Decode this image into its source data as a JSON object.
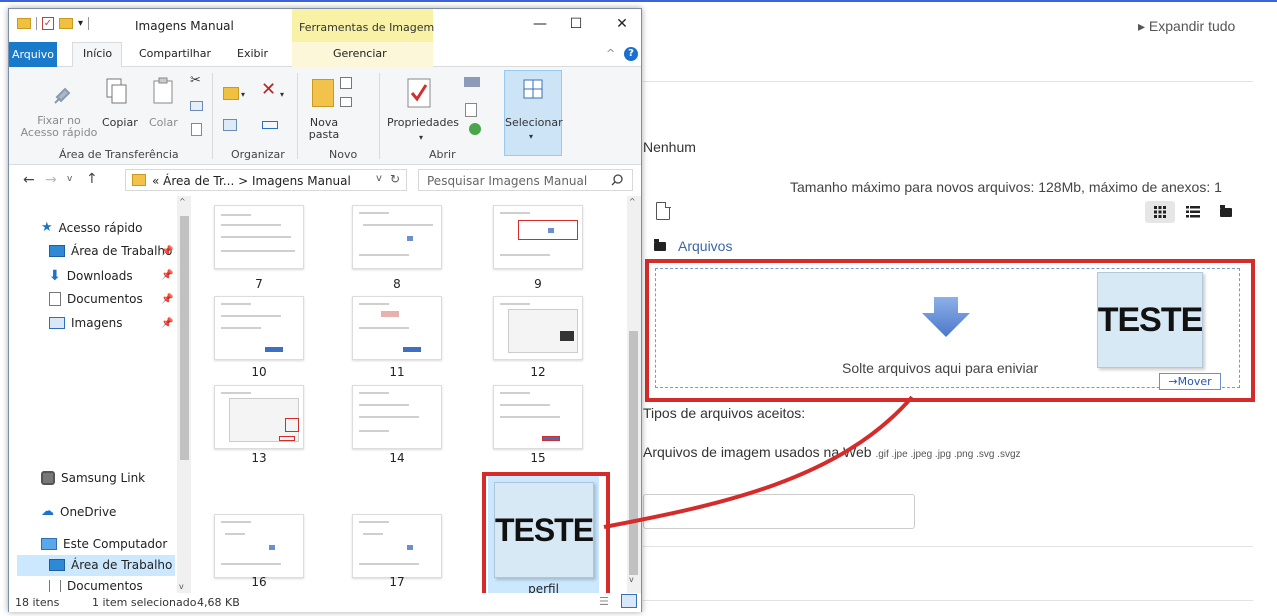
{
  "explorer": {
    "title": "Imagens Manual",
    "tools_tab": "Ferramentas de Imagem",
    "tabs": {
      "file": "Arquivo",
      "home": "Início",
      "share": "Compartilhar",
      "view": "Exibir",
      "manage": "Gerenciar"
    },
    "ribbon": {
      "pin_line1": "Fixar no",
      "pin_line2": "Acesso rápido",
      "copy": "Copiar",
      "paste": "Colar",
      "new_folder_1": "Nova",
      "new_folder_2": "pasta",
      "properties": "Propriedades",
      "select": "Selecionar",
      "groups": {
        "clipboard": "Área de Transferência",
        "organize": "Organizar",
        "new": "Novo",
        "open": "Abrir"
      }
    },
    "address": {
      "path_prefix": "«",
      "path_1": "Área de Tr...",
      "sep": ">",
      "path_2": "Imagens Manual",
      "search_placeholder": "Pesquisar Imagens Manual"
    },
    "nav": {
      "quick_access": "Acesso rápido",
      "desktop": "Área de Trabalho",
      "downloads": "Downloads",
      "documents": "Documentos",
      "images": "Imagens",
      "samsung": "Samsung Link",
      "onedrive": "OneDrive",
      "this_pc": "Este Computador",
      "desktop2": "Área de Trabalho",
      "documents2": "Documentos"
    },
    "files": [
      "7",
      "8",
      "9",
      "10",
      "11",
      "12",
      "13",
      "14",
      "15",
      "16",
      "17"
    ],
    "selected_file": "perfil",
    "selected_thumb_text": "TESTE",
    "status": {
      "count": "18 itens",
      "selection": "1 item selecionado",
      "size": "4,68 KB"
    }
  },
  "web": {
    "expand_all": "Expandir tudo",
    "none": "Nenhum",
    "max_size": "Tamanho máximo para novos arquivos: 128Mb, máximo de anexos: 1",
    "folder": "Arquivos",
    "drop_text": "Solte arquivos aqui para eniviar",
    "thumb_text": "TESTE",
    "move_label": "Mover",
    "accepted_types": "Tipos de arquivos aceitos:",
    "web_images": "Arquivos de imagem usados na Web",
    "extensions": ".gif .jpe .jpeg .jpg .png .svg .svgz"
  },
  "colors": {
    "highlight_red": "#d42b2b",
    "file_tab_blue": "#1979ca",
    "selection_blue": "#cce8ff",
    "tools_yellow": "#f9f2a6"
  }
}
